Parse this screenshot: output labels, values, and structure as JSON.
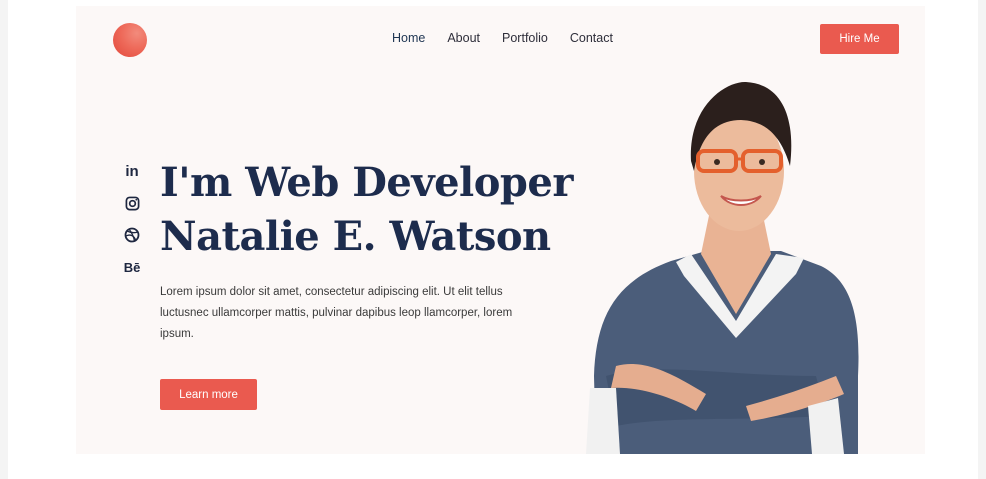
{
  "nav": {
    "items": [
      {
        "label": "Home",
        "active": true
      },
      {
        "label": "About"
      },
      {
        "label": "Portfolio"
      },
      {
        "label": "Contact"
      }
    ],
    "hire_label": "Hire Me"
  },
  "social": {
    "linkedin_label": "in",
    "behance_label": "Bē",
    "icons": [
      "linkedin-icon",
      "instagram-icon",
      "dribbble-icon",
      "behance-icon"
    ]
  },
  "hero": {
    "title_line1": "I'm Web Developer",
    "title_line2": "Natalie E. Watson",
    "description": "Lorem ipsum dolor sit amet, consectetur adipiscing elit. Ut elit tellus luctusnec ullamcorper mattis, pulvinar dapibus leop llamcorper, lorem ipsum.",
    "cta_label": "Learn more"
  },
  "colors": {
    "accent": "#ea5a4f",
    "heading": "#1d2c4d",
    "hero_bg": "#fcf8f7"
  }
}
